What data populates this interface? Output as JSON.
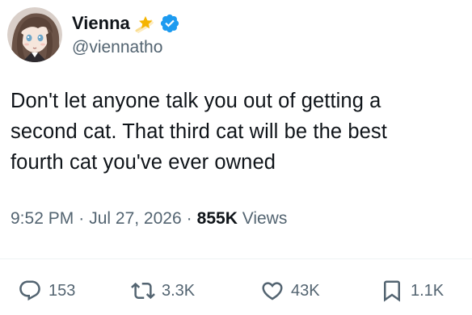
{
  "user": {
    "display_name": "Vienna",
    "handle": "@viennatho",
    "verified": true
  },
  "tweet": {
    "text_lines": [
      "Don't let anyone talk you out of getting a",
      "second cat. That third cat will be the best",
      "fourth cat you've ever owned"
    ],
    "time": "9:52 PM",
    "separator": "·",
    "date": "Jul 27, 2026",
    "views_count": "855K",
    "views_label": "Views"
  },
  "actions": {
    "replies": "153",
    "reposts": "3.3K",
    "likes": "43K",
    "bookmarks": "1.1K"
  },
  "icons": {
    "name_badge_emoji": "shooting-star-icon",
    "verified": "verified-badge-icon",
    "reply": "reply-icon",
    "repost": "repost-icon",
    "like": "heart-icon",
    "bookmark": "bookmark-icon"
  },
  "colors": {
    "text_primary": "#0f1419",
    "text_secondary": "#536471",
    "verified_blue": "#1d9bf0",
    "star_yellow": "#f5b400",
    "divider": "#eff3f4"
  }
}
